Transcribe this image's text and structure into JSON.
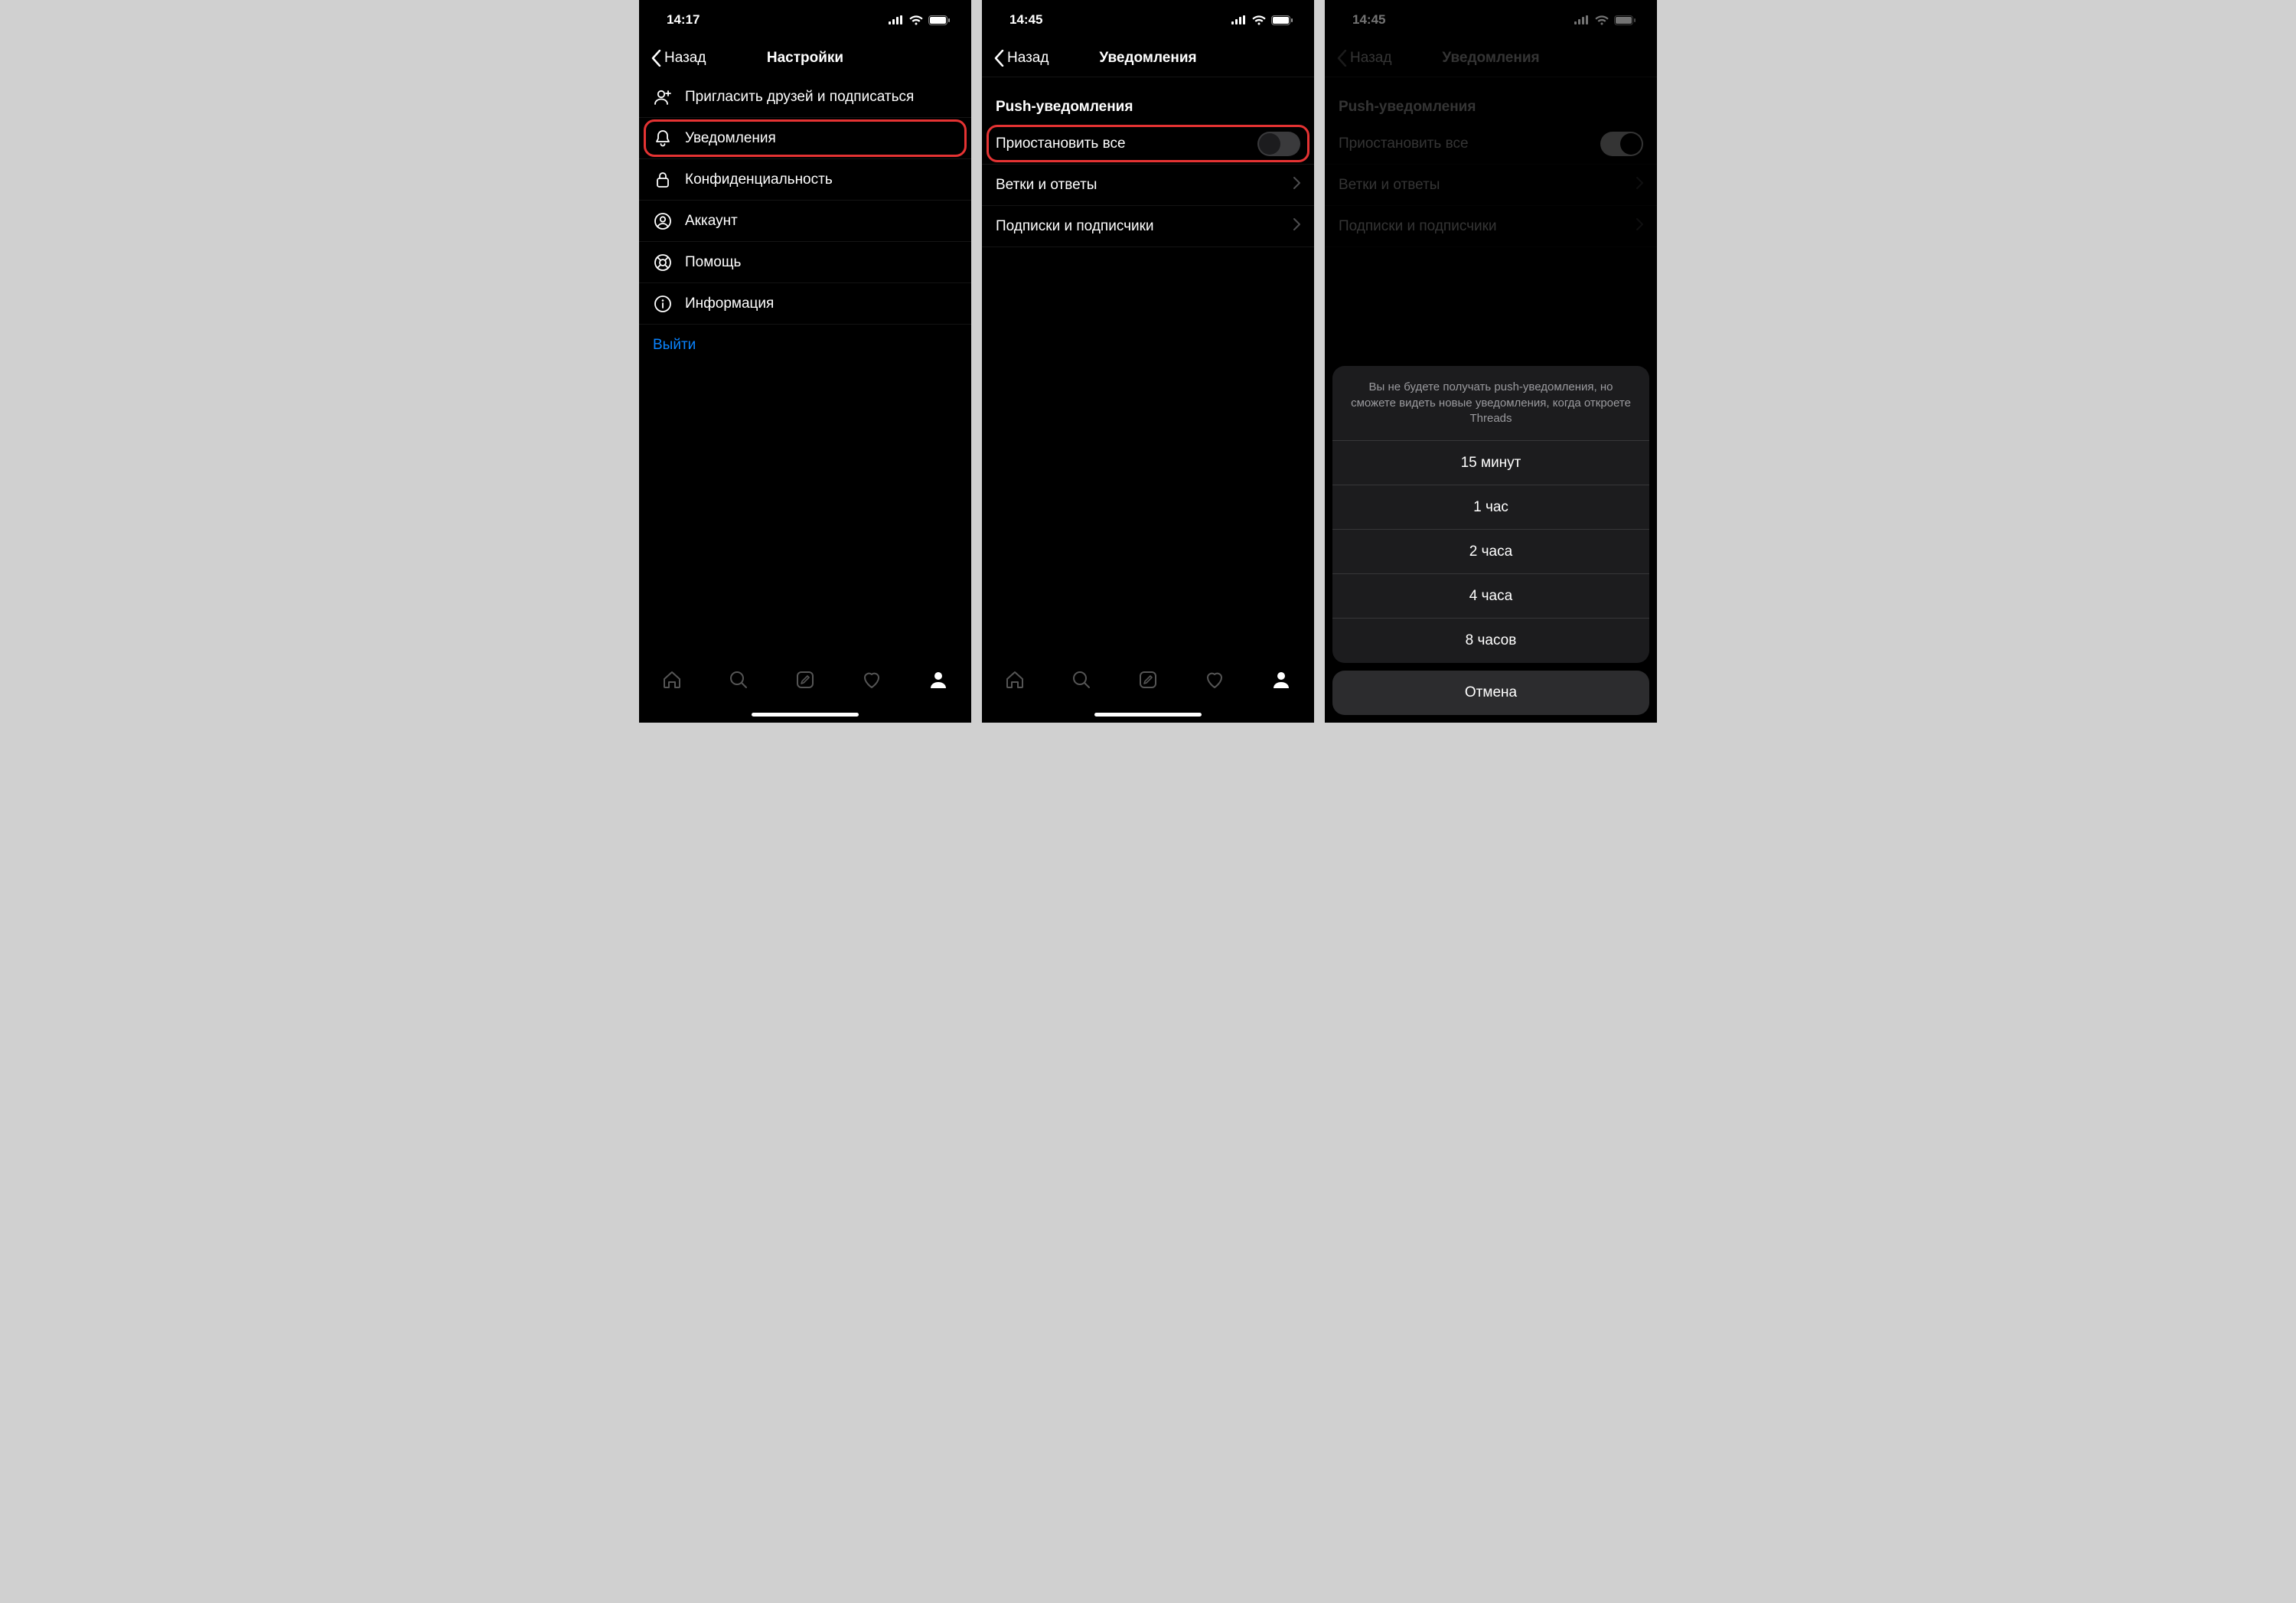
{
  "screens": [
    {
      "status_time": "14:17",
      "nav_back": "Назад",
      "nav_title": "Настройки",
      "items": [
        {
          "icon": "invite-icon",
          "label": "Пригласить друзей и подписаться"
        },
        {
          "icon": "bell-icon",
          "label": "Уведомления",
          "highlight": true
        },
        {
          "icon": "lock-icon",
          "label": "Конфиденциальность"
        },
        {
          "icon": "account-icon",
          "label": "Аккаунт"
        },
        {
          "icon": "help-icon",
          "label": "Помощь"
        },
        {
          "icon": "info-icon",
          "label": "Информация"
        }
      ],
      "logout_label": "Выйти"
    },
    {
      "status_time": "14:45",
      "nav_back": "Назад",
      "nav_title": "Уведомления",
      "section_header": "Push-уведомления",
      "rows": [
        {
          "label": "Приостановить все",
          "kind": "toggle",
          "on": false,
          "highlight": true
        },
        {
          "label": "Ветки и ответы",
          "kind": "chevron"
        },
        {
          "label": "Подписки и подписчики",
          "kind": "chevron"
        }
      ]
    },
    {
      "status_time": "14:45",
      "nav_back": "Назад",
      "nav_title": "Уведомления",
      "section_header": "Push-уведомления",
      "rows": [
        {
          "label": "Приостановить все",
          "kind": "toggle",
          "on": true
        },
        {
          "label": "Ветки и ответы",
          "kind": "chevron"
        },
        {
          "label": "Подписки и подписчики",
          "kind": "chevron"
        }
      ],
      "sheet": {
        "message": "Вы не будете получать push-уведомления, но сможете видеть новые уведомления, когда откроете Threads",
        "options": [
          "15 минут",
          "1 час",
          "2 часа",
          "4 часа",
          "8 часов"
        ],
        "cancel": "Отмена"
      }
    }
  ]
}
